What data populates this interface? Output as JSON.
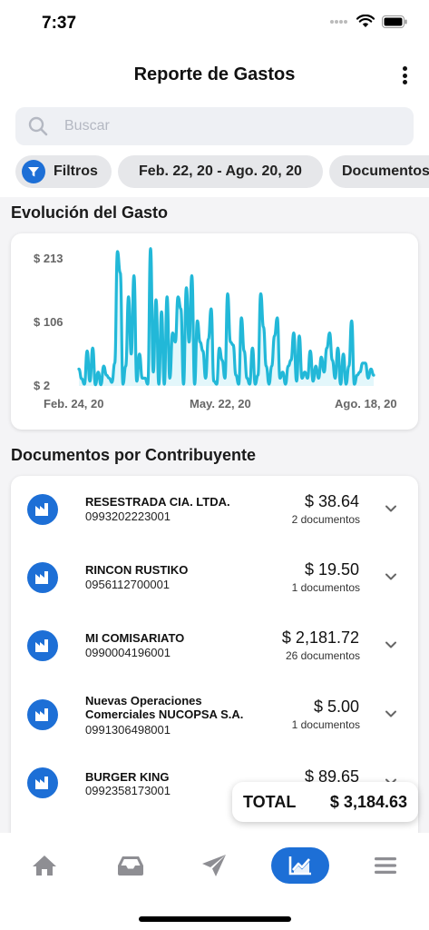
{
  "status": {
    "time": "7:37"
  },
  "header": {
    "title": "Reporte de Gastos"
  },
  "search": {
    "placeholder": "Buscar"
  },
  "chips": {
    "filters": "Filtros",
    "date_range": "Feb. 22, 20 - Ago. 20, 20",
    "documents": "Documentos"
  },
  "sections": {
    "chart_title": "Evolución del Gasto",
    "list_title": "Documentos por Contribuyente"
  },
  "chart_data": {
    "type": "area",
    "title": "",
    "xlabel": "",
    "ylabel": "",
    "y_tick_labels": [
      "$ 213",
      "$ 106",
      "$ 2"
    ],
    "x_tick_labels": [
      "Feb. 24, 20",
      "May. 22, 20",
      "Ago. 18, 20"
    ],
    "ylim": [
      2,
      213
    ],
    "grid": false,
    "line_color": "#22b8d8",
    "fill_color": "#e3f7fb",
    "values": [
      30,
      14,
      5,
      60,
      10,
      65,
      4,
      25,
      4,
      35,
      20,
      15,
      8,
      40,
      225,
      190,
      5,
      35,
      150,
      55,
      185,
      10,
      55,
      15,
      15,
      5,
      230,
      25,
      145,
      5,
      125,
      5,
      150,
      15,
      90,
      75,
      150,
      130,
      5,
      165,
      75,
      185,
      5,
      110,
      75,
      60,
      15,
      80,
      130,
      10,
      5,
      65,
      45,
      15,
      155,
      75,
      70,
      20,
      5,
      115,
      60,
      15,
      5,
      65,
      5,
      20,
      155,
      100,
      35,
      5,
      35,
      85,
      115,
      15,
      25,
      5,
      35,
      45,
      90,
      10,
      85,
      15,
      25,
      15,
      60,
      10,
      35,
      15,
      50,
      25,
      65,
      90,
      45,
      15,
      65,
      5,
      55,
      5,
      35,
      110,
      5,
      20,
      25,
      40,
      40,
      15,
      30,
      20
    ]
  },
  "contributors": [
    {
      "name": "RESESTRADA CIA. LTDA.",
      "ruc": "0993202223001",
      "amount": "$ 38.64",
      "docs": "2 documentos"
    },
    {
      "name": "RINCON RUSTIKO",
      "ruc": "0956112700001",
      "amount": "$ 19.50",
      "docs": "1 documentos"
    },
    {
      "name": "MI COMISARIATO",
      "ruc": "0990004196001",
      "amount": "$ 2,181.72",
      "docs": "26 documentos"
    },
    {
      "name": "Nuevas Operaciones Comerciales NUCOPSA S.A.",
      "ruc": "0991306498001",
      "amount": "$ 5.00",
      "docs": "1 documentos"
    },
    {
      "name": "BURGER KING",
      "ruc": "0992358173001",
      "amount": "$ 89.65",
      "docs": ""
    }
  ],
  "total": {
    "label": "TOTAL",
    "value": "$ 3,184.63"
  },
  "colors": {
    "accent": "#1d6fd6",
    "chart_line": "#22b8d8",
    "icon_gray": "#8e8e93"
  },
  "tabs": [
    {
      "icon": "home-icon"
    },
    {
      "icon": "inbox-icon"
    },
    {
      "icon": "send-icon"
    },
    {
      "icon": "chart-icon",
      "active": true
    },
    {
      "icon": "menu-icon"
    }
  ]
}
